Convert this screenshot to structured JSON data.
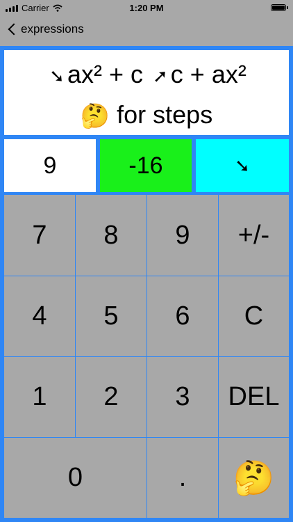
{
  "status_bar": {
    "carrier": "Carrier",
    "time": "1:20 PM"
  },
  "nav": {
    "back_label": "expressions"
  },
  "header": {
    "arrow_down": "➘",
    "expr_left": "ax² + c",
    "arrow_up": "➚",
    "expr_right": "c + ax²",
    "think_emoji": "🤔",
    "steps_label": "for steps"
  },
  "inputs": {
    "a_value": "9",
    "c_value": "-16",
    "direction": "➘"
  },
  "keypad": {
    "keys": [
      "7",
      "8",
      "9",
      "+/-",
      "4",
      "5",
      "6",
      "C",
      "1",
      "2",
      "3",
      "DEL",
      "0",
      ".",
      "🤔"
    ]
  },
  "colors": {
    "accent": "#2f86f5",
    "c_field": "#19f01a",
    "dir_field": "#00ffff",
    "key_bg": "#a8a8a8"
  }
}
